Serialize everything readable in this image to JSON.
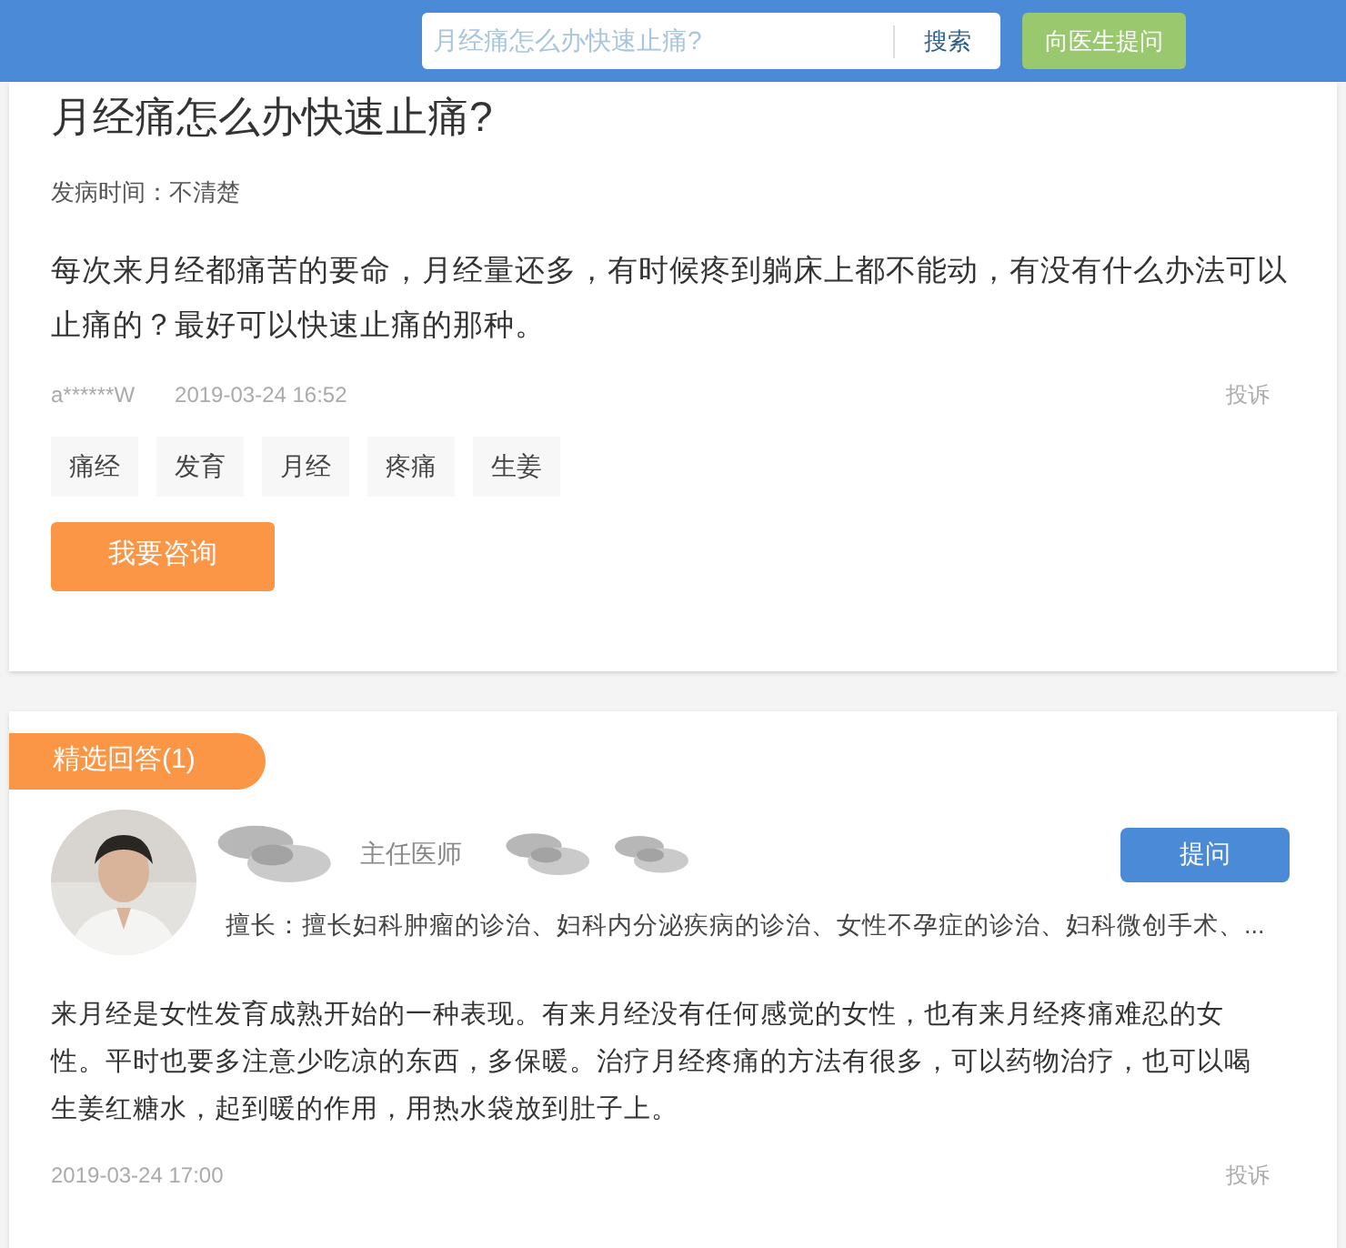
{
  "header": {
    "search": {
      "placeholder": "月经痛怎么办快速止痛?"
    },
    "search_button": "搜索",
    "ask_button": "向医生提问"
  },
  "question": {
    "title": "月经痛怎么办快速止痛?",
    "onset": "发病时间：不清楚",
    "body": "每次来月经都痛苦的要命，月经量还多，有时候疼到躺床上都不能动，有没有什么办法可以止痛的？最好可以快速止痛的那种。",
    "user": "a******W",
    "time": "2019-03-24 16:52",
    "report": "投诉",
    "tags": [
      "痛经",
      "发育",
      "月经",
      "疼痛",
      "生姜"
    ],
    "consult_button": "我要咨询"
  },
  "answers": {
    "heading": "精选回答(1)",
    "items": [
      {
        "doctor_title": "主任医师",
        "ask_button": "提问",
        "specialty": "擅长：擅长妇科肿瘤的诊治、妇科内分泌疾病的诊治、女性不孕症的诊治、妇科微创手术、...",
        "body": "来月经是女性发育成熟开始的一种表现。有来月经没有任何感觉的女性，也有来月经疼痛难忍的女性。平时也要多注意少吃凉的东西，多保暖。治疗月经疼痛的方法有很多，可以药物治疗，也可以喝生姜红糖水，起到暖的作用，用热水袋放到肚子上。",
        "time": "2019-03-24 17:00",
        "report": "投诉"
      }
    ]
  }
}
